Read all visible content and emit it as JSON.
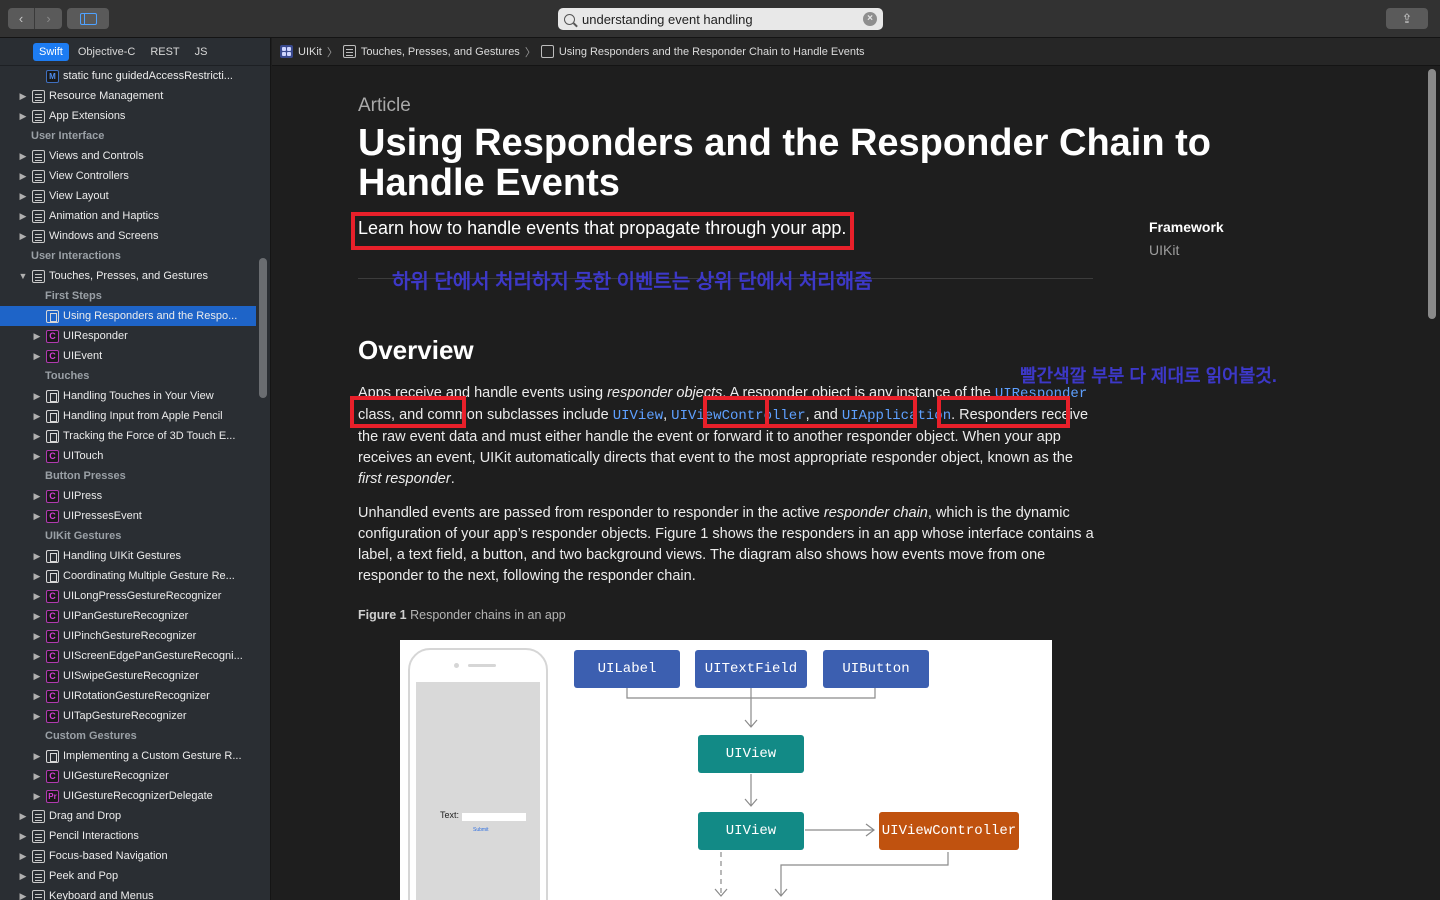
{
  "toolbar": {
    "back_glyph": "‹",
    "forward_glyph": "›",
    "search_query": "understanding event handling",
    "share_glyph": "⇪"
  },
  "sidebar": {
    "languages": [
      "Swift",
      "Objective-C",
      "REST",
      "JS"
    ],
    "rows": [
      {
        "label": "static func guidedAccessRestricti...",
        "type": "item",
        "indent": 2,
        "icon": "meth",
        "tri": ""
      },
      {
        "label": "Resource Management",
        "type": "item",
        "indent": 1,
        "icon": "doc",
        "tri": "▶"
      },
      {
        "label": "App Extensions",
        "type": "item",
        "indent": 1,
        "icon": "doc",
        "tri": "▶"
      },
      {
        "label": "User Interface",
        "type": "section",
        "indent": 1,
        "icon": "",
        "tri": ""
      },
      {
        "label": "Views and Controls",
        "type": "item",
        "indent": 1,
        "icon": "doc",
        "tri": "▶"
      },
      {
        "label": "View Controllers",
        "type": "item",
        "indent": 1,
        "icon": "doc",
        "tri": "▶"
      },
      {
        "label": "View Layout",
        "type": "item",
        "indent": 1,
        "icon": "doc",
        "tri": "▶"
      },
      {
        "label": "Animation and Haptics",
        "type": "item",
        "indent": 1,
        "icon": "doc",
        "tri": "▶"
      },
      {
        "label": "Windows and Screens",
        "type": "item",
        "indent": 1,
        "icon": "doc",
        "tri": "▶"
      },
      {
        "label": "User Interactions",
        "type": "section",
        "indent": 1,
        "icon": "",
        "tri": ""
      },
      {
        "label": "Touches, Presses, and Gestures",
        "type": "item",
        "indent": 1,
        "icon": "doc",
        "tri": "▼"
      },
      {
        "label": "First Steps",
        "type": "section",
        "indent": 2,
        "icon": "",
        "tri": ""
      },
      {
        "label": "Using Responders and the Respo...",
        "type": "selected",
        "indent": 2,
        "icon": "art",
        "tri": ""
      },
      {
        "label": "UIResponder",
        "type": "item",
        "indent": 2,
        "icon": "cls",
        "tri": "▶"
      },
      {
        "label": "UIEvent",
        "type": "item",
        "indent": 2,
        "icon": "cls",
        "tri": "▶"
      },
      {
        "label": "Touches",
        "type": "section",
        "indent": 2,
        "icon": "",
        "tri": ""
      },
      {
        "label": "Handling Touches in Your View",
        "type": "item",
        "indent": 2,
        "icon": "art",
        "tri": "▶"
      },
      {
        "label": "Handling Input from Apple Pencil",
        "type": "item",
        "indent": 2,
        "icon": "art",
        "tri": "▶"
      },
      {
        "label": "Tracking the Force of 3D Touch E...",
        "type": "item",
        "indent": 2,
        "icon": "art",
        "tri": "▶"
      },
      {
        "label": "UITouch",
        "type": "item",
        "indent": 2,
        "icon": "cls",
        "tri": "▶"
      },
      {
        "label": "Button Presses",
        "type": "section",
        "indent": 2,
        "icon": "",
        "tri": ""
      },
      {
        "label": "UIPress",
        "type": "item",
        "indent": 2,
        "icon": "cls",
        "tri": "▶"
      },
      {
        "label": "UIPressesEvent",
        "type": "item",
        "indent": 2,
        "icon": "cls",
        "tri": "▶"
      },
      {
        "label": "UIKit Gestures",
        "type": "section",
        "indent": 2,
        "icon": "",
        "tri": ""
      },
      {
        "label": "Handling UIKit Gestures",
        "type": "item",
        "indent": 2,
        "icon": "art",
        "tri": "▶"
      },
      {
        "label": "Coordinating Multiple Gesture Re...",
        "type": "item",
        "indent": 2,
        "icon": "art",
        "tri": "▶"
      },
      {
        "label": "UILongPressGestureRecognizer",
        "type": "item",
        "indent": 2,
        "icon": "cls",
        "tri": "▶"
      },
      {
        "label": "UIPanGestureRecognizer",
        "type": "item",
        "indent": 2,
        "icon": "cls",
        "tri": "▶"
      },
      {
        "label": "UIPinchGestureRecognizer",
        "type": "item",
        "indent": 2,
        "icon": "cls",
        "tri": "▶"
      },
      {
        "label": "UIScreenEdgePanGestureRecogni...",
        "type": "item",
        "indent": 2,
        "icon": "cls",
        "tri": "▶"
      },
      {
        "label": "UISwipeGestureRecognizer",
        "type": "item",
        "indent": 2,
        "icon": "cls",
        "tri": "▶"
      },
      {
        "label": "UIRotationGestureRecognizer",
        "type": "item",
        "indent": 2,
        "icon": "cls",
        "tri": "▶"
      },
      {
        "label": "UITapGestureRecognizer",
        "type": "item",
        "indent": 2,
        "icon": "cls",
        "tri": "▶"
      },
      {
        "label": "Custom Gestures",
        "type": "section",
        "indent": 2,
        "icon": "",
        "tri": ""
      },
      {
        "label": "Implementing a Custom Gesture R...",
        "type": "item",
        "indent": 2,
        "icon": "art",
        "tri": "▶"
      },
      {
        "label": "UIGestureRecognizer",
        "type": "item",
        "indent": 2,
        "icon": "cls",
        "tri": "▶"
      },
      {
        "label": "UIGestureRecognizerDelegate",
        "type": "item",
        "indent": 2,
        "icon": "proto",
        "tri": "▶"
      },
      {
        "label": "Drag and Drop",
        "type": "item",
        "indent": 1,
        "icon": "doc",
        "tri": "▶"
      },
      {
        "label": "Pencil Interactions",
        "type": "item",
        "indent": 1,
        "icon": "doc",
        "tri": "▶"
      },
      {
        "label": "Focus-based Navigation",
        "type": "item",
        "indent": 1,
        "icon": "doc",
        "tri": "▶"
      },
      {
        "label": "Peek and Pop",
        "type": "item",
        "indent": 1,
        "icon": "doc",
        "tri": "▶"
      },
      {
        "label": "Keyboard and Menus",
        "type": "item",
        "indent": 1,
        "icon": "doc",
        "tri": "▶"
      }
    ]
  },
  "breadcrumb": {
    "items": [
      "UIKit",
      "Touches, Presses, and Gestures",
      "Using Responders and the Responder Chain to Handle Events"
    ],
    "separator": "〉"
  },
  "article": {
    "eyebrow": "Article",
    "title": "Using Responders and the Responder Chain to Handle Events",
    "abstract": "Learn how to handle events that propagate through your app.",
    "framework_label": "Framework",
    "framework_value": "UIKit",
    "overview_heading": "Overview",
    "p1_a": "Apps receive and handle events using ",
    "p1_b": "responder objects",
    "p1_c": ". A responder object is any instance of the ",
    "p1_code1": "UIResponder",
    "p1_d": " class, and common subclasses include ",
    "p1_code2": "UIView",
    "p1_e": ", ",
    "p1_code3": "UIViewController",
    "p1_f": ", and ",
    "p1_code4": "UIApplication",
    "p1_g": ". Responders receive the raw event data and must either handle the event or forward it to another responder object. When your app receives an event, UIKit automatically directs that event to the most appropriate responder object, known as the ",
    "p1_h": "first responder",
    "p1_i": ".",
    "p2_a": "Unhandled events are passed from responder to responder in the active ",
    "p2_b": "responder chain",
    "p2_c": ", which is the dynamic configuration of your app’s responder objects. Figure 1 shows the responders in an app whose interface contains a label, a text field, a button, and two background views. The diagram also shows how events move from one responder to the next, following the responder chain.",
    "caption_bold": "Figure 1",
    "caption_text": " Responder chains in an app"
  },
  "annotations": {
    "korean_strike": "하위 단에서 처리하지 못한 이벤트는 상위 단에서 처리해줌",
    "korean_note": "빨간색깔 부분 다 제대로 읽어볼것.",
    "box_color": "#e8202a",
    "text_color": "#3d38c8"
  },
  "figure": {
    "phone_label": "Text:",
    "phone_button": "Submit",
    "nodes": [
      "UILabel",
      "UITextField",
      "UIButton",
      "UIView",
      "UIView",
      "UIViewController"
    ]
  },
  "colors": {
    "accent": "#1d7cf2",
    "link": "#5ea0ff",
    "node_blue": "#3c5fb0",
    "node_teal": "#128a86",
    "node_orange": "#c0520f"
  }
}
